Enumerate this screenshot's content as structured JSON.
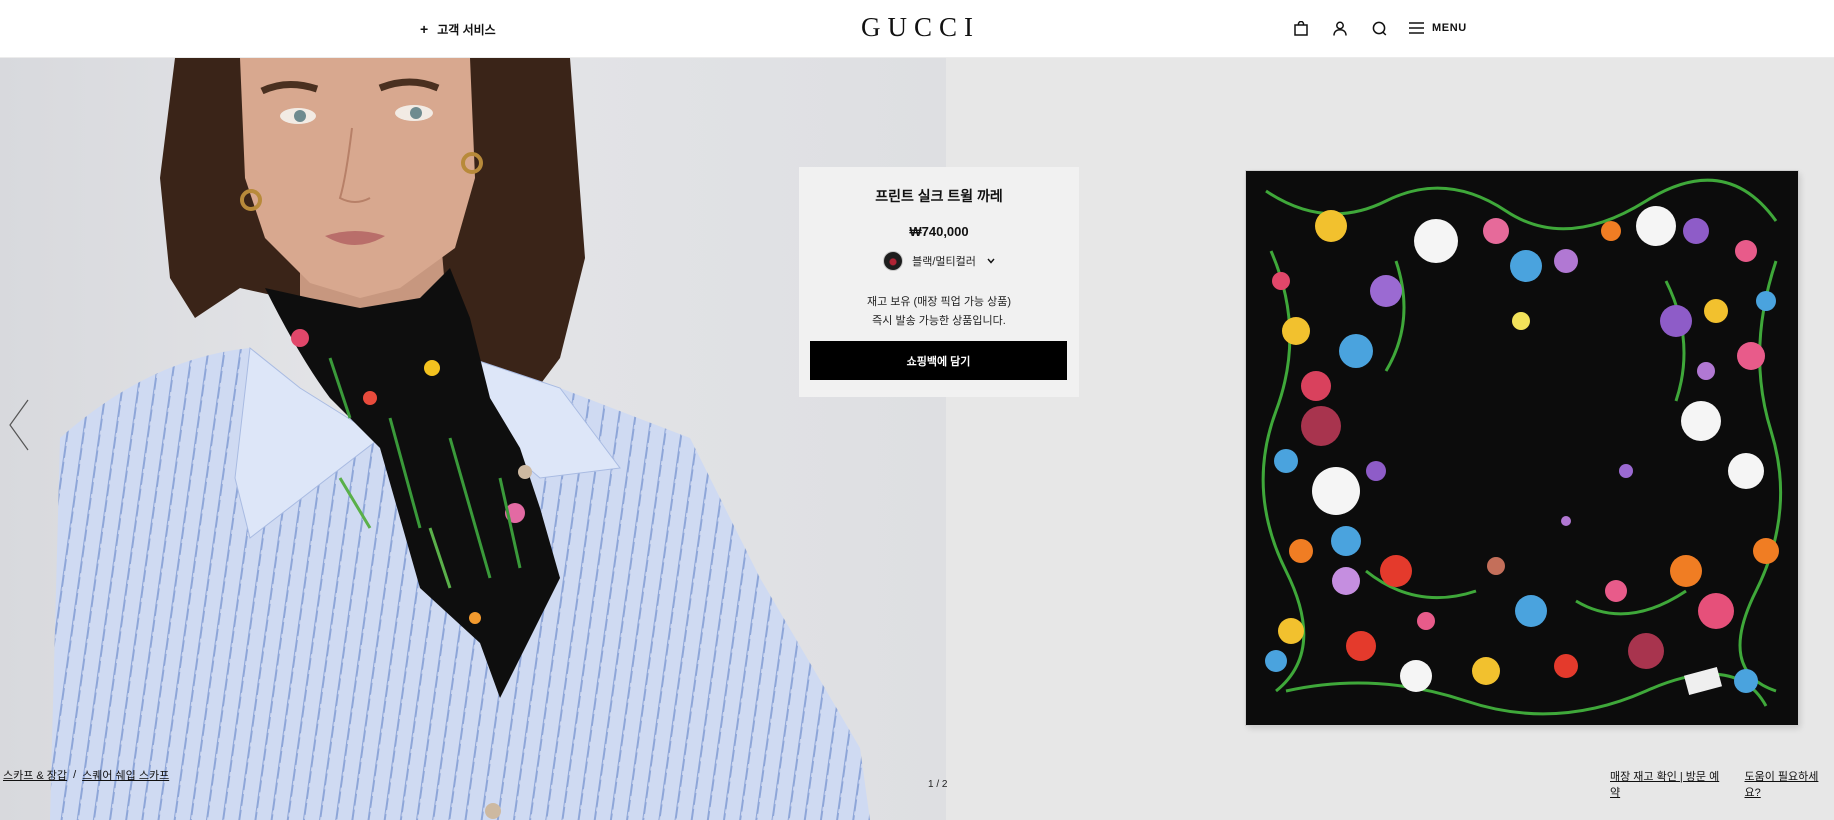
{
  "header": {
    "customer_service": "고객 서비스",
    "logo": "GUCCI",
    "menu_label": "MENU",
    "icons": [
      "shopping-bag-icon",
      "user-icon",
      "search-icon",
      "hamburger-icon"
    ]
  },
  "product": {
    "title": "프린트 실크 트윌 까레",
    "price": "₩740,000",
    "color": "블랙/멀티컬러",
    "stock_line1": "재고 보유 (매장 픽업 가능 상품)",
    "stock_line2": "즉시 발송 가능한 상품입니다.",
    "add_to_bag": "쇼핑백에 담기"
  },
  "gallery": {
    "pager": "1 / 2",
    "prev_icon": "chevron-left-icon"
  },
  "breadcrumb": {
    "items": [
      "스카프 & 장갑",
      "스퀘어 쉐입 스카프"
    ],
    "separator": "/"
  },
  "footer_links": {
    "store_stock": "매장 재고 확인 | 방문 예약",
    "help": "도움이 필요하세요?"
  },
  "colors": {
    "button_bg": "#000000",
    "card_bg": "#f1f1f1",
    "right_panel_bg": "#e7e7e7"
  }
}
